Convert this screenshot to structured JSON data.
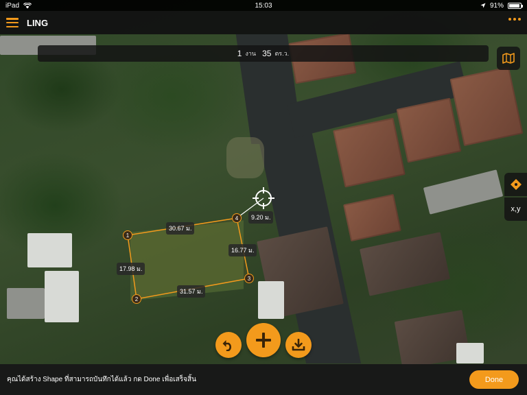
{
  "status_bar": {
    "device": "iPad",
    "time": "15:03",
    "battery": "91%",
    "battery_level": 0.91
  },
  "nav": {
    "title": "LING",
    "menu_icon": "hamburger-icon",
    "more_icon": "more-dots-icon"
  },
  "area": {
    "ngan_value": "1",
    "ngan_unit": "งาน",
    "wah_value": "35",
    "wah_unit": "ตร.ว."
  },
  "side_buttons": {
    "map_icon": "map-icon",
    "point_icon": "diamond-point-icon",
    "xy_label": "x,y"
  },
  "plot": {
    "vertices": [
      {
        "label": "1"
      },
      {
        "label": "2"
      },
      {
        "label": "3"
      },
      {
        "label": "4"
      }
    ],
    "edges": [
      {
        "label": "30.67 ม."
      },
      {
        "label": "17.98 ม."
      },
      {
        "label": "31.57 ม."
      },
      {
        "label": "16.77 ม."
      }
    ],
    "cursor_distance": "9.20 ม."
  },
  "actions": {
    "undo_icon": "undo-icon",
    "add_icon": "plus-icon",
    "save_icon": "download-icon"
  },
  "bottom": {
    "hint": "คุณได้สร้าง Shape ที่สามารถบันทึกได้แล้ว กด Done เพื่อเสร็จสิ้น",
    "done_label": "Done"
  },
  "colors": {
    "accent": "#f39a1c",
    "bar_bg": "#141414"
  }
}
